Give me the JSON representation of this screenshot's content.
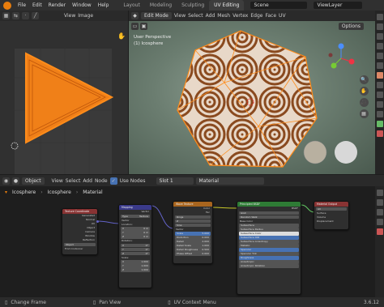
{
  "topbar": {
    "menus": [
      "File",
      "Edit",
      "Render",
      "Window",
      "Help"
    ],
    "tabs": [
      "Layout",
      "Modeling",
      "Sculpting",
      "UV Editing"
    ],
    "scene": "Scene",
    "viewlayer": "ViewLayer"
  },
  "uv_editor": {
    "header": [
      "View",
      "Image"
    ]
  },
  "viewport": {
    "mode": "Edit Mode",
    "menus": [
      "View",
      "Select",
      "Add",
      "Mesh",
      "Vertex",
      "Edge",
      "Face",
      "UV"
    ],
    "options": "Options",
    "overlay_title": "User Perspective",
    "overlay_obj": "(1) Icosphere"
  },
  "node_header": {
    "object_type": "Object",
    "menus": [
      "View",
      "Select",
      "Add",
      "Node"
    ],
    "use_nodes": "Use Nodes",
    "slot": "Slot 1",
    "material": "Material"
  },
  "breadcrumb": [
    "Icosphere",
    "Icosphere",
    "Material"
  ],
  "nodes": {
    "texcoord": {
      "title": "Texture Coordinate",
      "outputs": [
        "Generated",
        "Normal",
        "UV",
        "Object",
        "Camera",
        "Window",
        "Reflection"
      ],
      "object_label": "Object",
      "from_instancer": "From Instancer"
    },
    "mapping": {
      "title": "Mapping",
      "out": "Vector",
      "type_label": "Type",
      "type_value": "Texture",
      "vector": "Vector",
      "location": "Location:",
      "loc": [
        "0 m",
        "0 m",
        "0 m"
      ],
      "rotation": "Rotation:",
      "rot": [
        "0°",
        "0°",
        "0°"
      ],
      "scale": "Scale:",
      "scl": [
        "1.000",
        "1.000",
        "1.000"
      ]
    },
    "wave": {
      "title": "Wave Texture",
      "outputs": [
        "Color",
        "Fac"
      ],
      "type1": "Rings",
      "type2": "Z",
      "type3": "Sine",
      "vector": "Vector",
      "fields": [
        [
          "Scale",
          "5.000"
        ],
        [
          "Distortion",
          "0.000"
        ],
        [
          "Detail",
          "2.000"
        ],
        [
          "Detail Scale",
          "1.000"
        ],
        [
          "Detail Roughness",
          "0.500"
        ],
        [
          "Phase Offset",
          "0.000"
        ]
      ]
    },
    "bsdf": {
      "title": "Principled BSDF",
      "out": "BSDF",
      "dist": "GGX",
      "sss": "Random Walk",
      "rows": [
        "Base Color",
        "Subsurface",
        "Subsurface Radius",
        "Subsurface Color",
        "Subsurface IOR",
        "Subsurface Anisotropy",
        "Metallic",
        "Specular",
        "Specular Tint",
        "Roughness",
        "Anisotropic",
        "Anisotropic Rotation"
      ]
    },
    "output": {
      "title": "Material Output",
      "target": "All",
      "inputs": [
        "Surface",
        "Volume",
        "Displacement"
      ]
    }
  },
  "statusbar": {
    "items": [
      "Change Frame",
      "Pan View",
      "UV Context Menu"
    ],
    "version": "3.6.12"
  },
  "colors": {
    "accent": "#e87d0d",
    "selected": "#4772b3"
  }
}
